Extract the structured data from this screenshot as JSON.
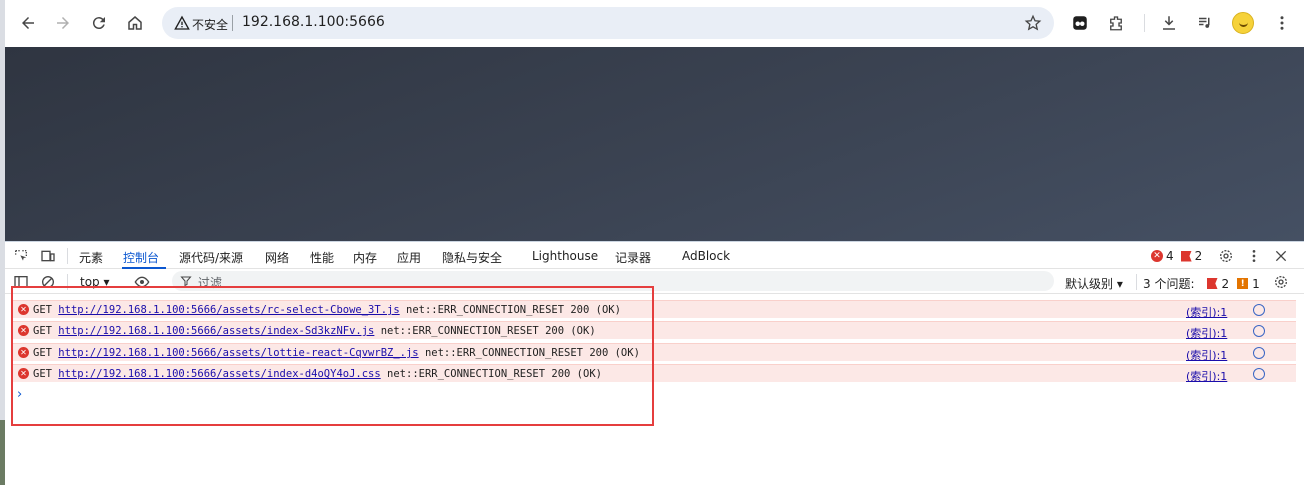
{
  "browser": {
    "insecure_label": "不安全",
    "url": "192.168.1.100:5666"
  },
  "devtools": {
    "tabs": [
      "元素",
      "控制台",
      "源代码/来源",
      "网络",
      "性能",
      "内存",
      "应用",
      "隐私与安全",
      "Lighthouse",
      "记录器",
      "AdBlock"
    ],
    "active_tab": "控制台",
    "error_count": "4",
    "issue_flag_count": "2",
    "filter": {
      "context": "top ▾",
      "placeholder": "过滤",
      "levels": "默认级别 ▾",
      "issues_label": "3 个问题:",
      "issues_errors": "2",
      "issues_warnings": "1"
    },
    "console_rows": [
      {
        "method": "GET",
        "url": "http://192.168.1.100:5666/assets/rc-select-Cbowe_3T.js",
        "message": "net::ERR_CONNECTION_RESET 200 (OK)",
        "source": "(索引):1"
      },
      {
        "method": "GET",
        "url": "http://192.168.1.100:5666/assets/index-Sd3kzNFv.js",
        "message": "net::ERR_CONNECTION_RESET 200 (OK)",
        "source": "(索引):1"
      },
      {
        "method": "GET",
        "url": "http://192.168.1.100:5666/assets/lottie-react-CqvwrBZ_.js",
        "message": "net::ERR_CONNECTION_RESET 200 (OK)",
        "source": "(索引):1"
      },
      {
        "method": "GET",
        "url": "http://192.168.1.100:5666/assets/index-d4oQY4oJ.css",
        "message": "net::ERR_CONNECTION_RESET 200 (OK)",
        "source": "(索引):1"
      }
    ],
    "prompt": "›"
  },
  "colors": {
    "accent": "#0b57d0",
    "error": "#dc362e",
    "error_row_bg": "#fce8e6",
    "highlight_box": "#e53e3e"
  }
}
